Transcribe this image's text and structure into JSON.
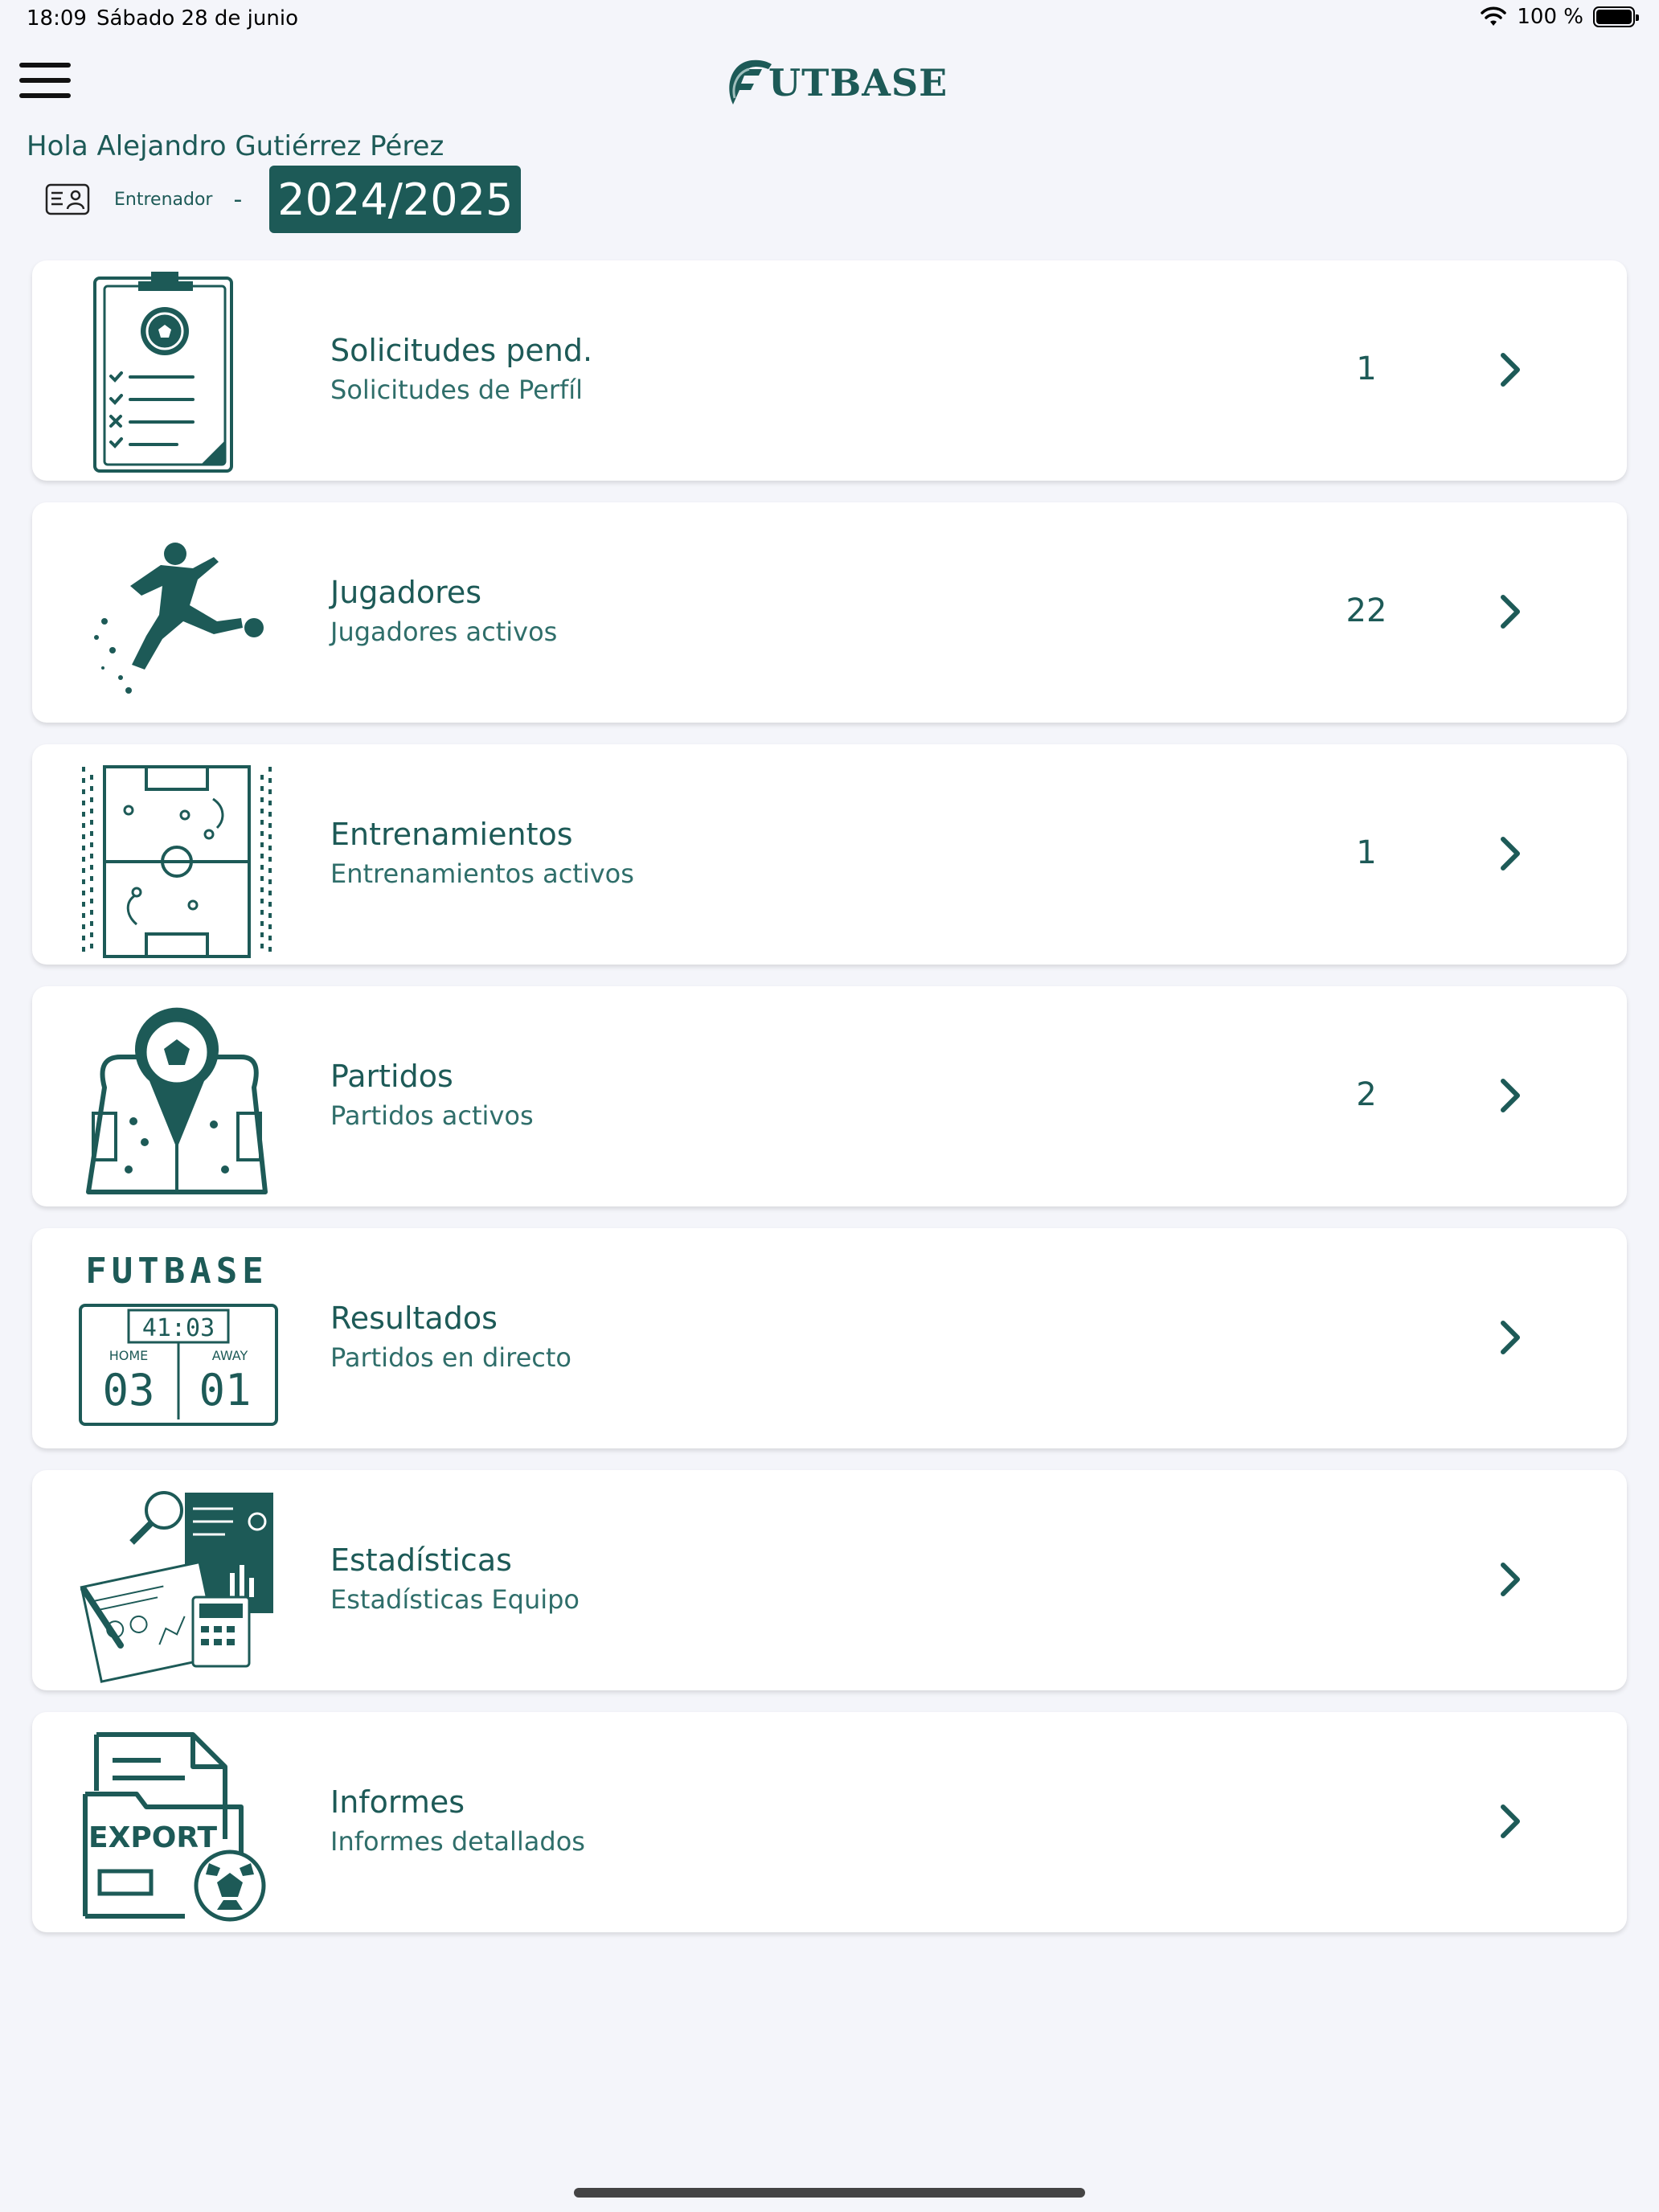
{
  "status_bar": {
    "time": "18:09",
    "date": "Sábado 28 de junio",
    "battery": "100 %"
  },
  "header": {
    "logo_text": "UTBASE",
    "greeting": "Hola Alejandro Gutiérrez Pérez",
    "role": "Entrenador",
    "separator": "-",
    "season": "2024/2025"
  },
  "colors": {
    "primary": "#1d5a57",
    "background": "#f4f5fa",
    "card": "#ffffff"
  },
  "cards": [
    {
      "title": "Solicitudes pend.",
      "subtitle": "Solicitudes de Perfíl",
      "count": "1",
      "icon": "clipboard-icon"
    },
    {
      "title": "Jugadores",
      "subtitle": "Jugadores activos",
      "count": "22",
      "icon": "player-kick-icon"
    },
    {
      "title": "Entrenamientos",
      "subtitle": "Entrenamientos activos",
      "count": "1",
      "icon": "tactics-board-icon"
    },
    {
      "title": "Partidos",
      "subtitle": "Partidos activos",
      "count": "2",
      "icon": "match-field-icon"
    },
    {
      "title": "Resultados",
      "subtitle": "Partidos en directo",
      "count": "",
      "icon": "scoreboard-icon",
      "scoreboard": {
        "brand": "FUTBASE",
        "clock": "41:03",
        "home_label": "HOME",
        "away_label": "AWAY",
        "home": "03",
        "away": "01"
      }
    },
    {
      "title": "Estadísticas",
      "subtitle": "Estadísticas Equipo",
      "count": "",
      "icon": "statistics-icon"
    },
    {
      "title": "Informes",
      "subtitle": "Informes detallados",
      "count": "",
      "icon": "export-report-icon",
      "export_label": "EXPORT"
    }
  ]
}
